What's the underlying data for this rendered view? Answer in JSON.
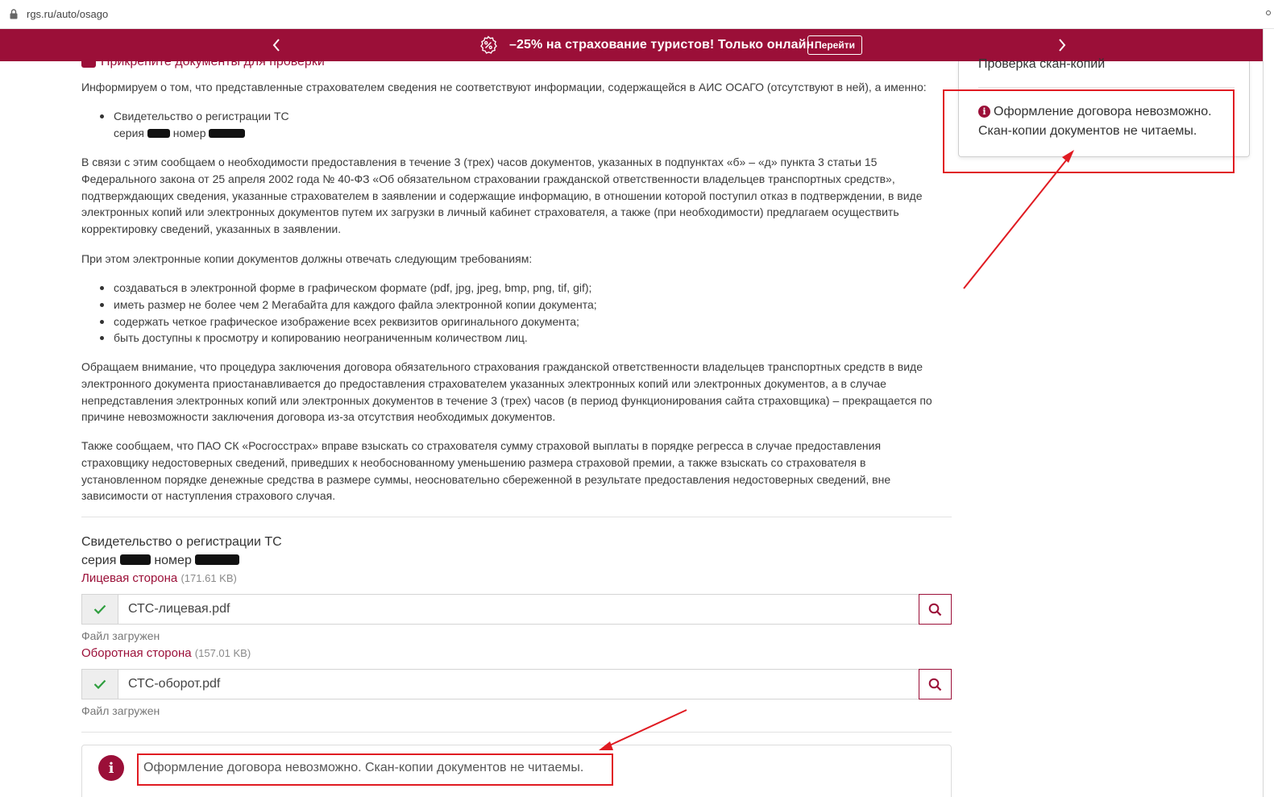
{
  "browser": {
    "url": "rgs.ru/auto/osago"
  },
  "promo": {
    "text": "–25% на страхование туристов! Только онлайн.",
    "button": "Перейти"
  },
  "content": {
    "attach_title": "Прикрепите документы для проверки",
    "intro": "Информируем о том, что представленные страхователем сведения не соответствуют информации, содержащейся в АИС ОСАГО (отсутствуют в ней), а именно:",
    "doc_item_title": "Свидетельство о регистрации ТС",
    "doc_item_series": "серия",
    "doc_item_number": "номер",
    "para1": "В связи с этим сообщаем о необходимости предоставления в течение 3 (трех) часов документов, указанных в подпунктах «б» – «д» пункта 3 статьи 15 Федерального закона от 25 апреля 2002 года № 40-ФЗ «Об обязательном страховании гражданской ответственности владельцев транспортных средств», подтверждающих сведения, указанные страхователем в заявлении и содержащие информацию, в отношении которой поступил отказ в подтверждении, в виде электронных копий или электронных документов путем их загрузки в личный кабинет страхователя, а также (при необходимости) предлагаем осуществить корректировку сведений, указанных в заявлении.",
    "para2": "При этом электронные копии документов должны отвечать следующим требованиям:",
    "requirements": [
      "создаваться в электронной форме в графическом формате (pdf, jpg, jpeg, bmp, png, tif, gif);",
      "иметь размер не более чем 2 Мегабайта для каждого файла электронной копии документа;",
      "содержать четкое графическое изображение всех реквизитов оригинального документа;",
      "быть доступны к просмотру и копированию неограниченным количеством лиц."
    ],
    "para3": "Обращаем внимание, что процедура заключения договора обязательного страхования гражданской ответственности владельцев транспортных средств в виде электронного документа приостанавливается до предоставления страхователем указанных электронных копий или электронных документов, а в случае непредставления электронных копий или электронных документов в течение 3 (трех) часов (в период функционирования сайта страховщика) – прекращается по причине невозможности заключения договора из-за отсутствия необходимых документов.",
    "para4": "Также сообщаем, что ПАО СК «Росгосстрах» вправе взыскать со страхователя сумму страховой выплаты в порядке регресса в случае предоставления страховщику недостоверных сведений, приведших к необоснованному уменьшению размера страховой премии, а также взыскать со страхователя в установленном порядке денежные средства в размере суммы, неосновательно сбереженной в результате предоставления недостоверных сведений, вне зависимости от наступления страхового случая."
  },
  "upload": {
    "doc_title": "Свидетельство о регистрации ТС",
    "series": "серия",
    "number": "номер",
    "front": {
      "label": "Лицевая сторона",
      "size": "(171.61 KB)",
      "file": "СТС-лицевая.pdf",
      "status": "Файл загружен"
    },
    "back": {
      "label": "Оборотная сторона",
      "size": "(157.01 KB)",
      "file": "СТС-оборот.pdf",
      "status": "Файл загружен"
    },
    "error": "Оформление договора невозможно. Скан-копии документов не читаемы."
  },
  "panel": {
    "title": "Проверка скан-копий",
    "message": "Оформление договора невозможно. Скан-копии документов не читаемы."
  },
  "colors": {
    "brand": "#9b0f38",
    "annotation": "#e01b22",
    "success": "#2e9e3e"
  },
  "icons": [
    "lock-icon",
    "chevron-left-icon",
    "chevron-right-icon",
    "percent-badge-icon",
    "upload-icon",
    "check-icon",
    "search-icon",
    "info-icon"
  ]
}
